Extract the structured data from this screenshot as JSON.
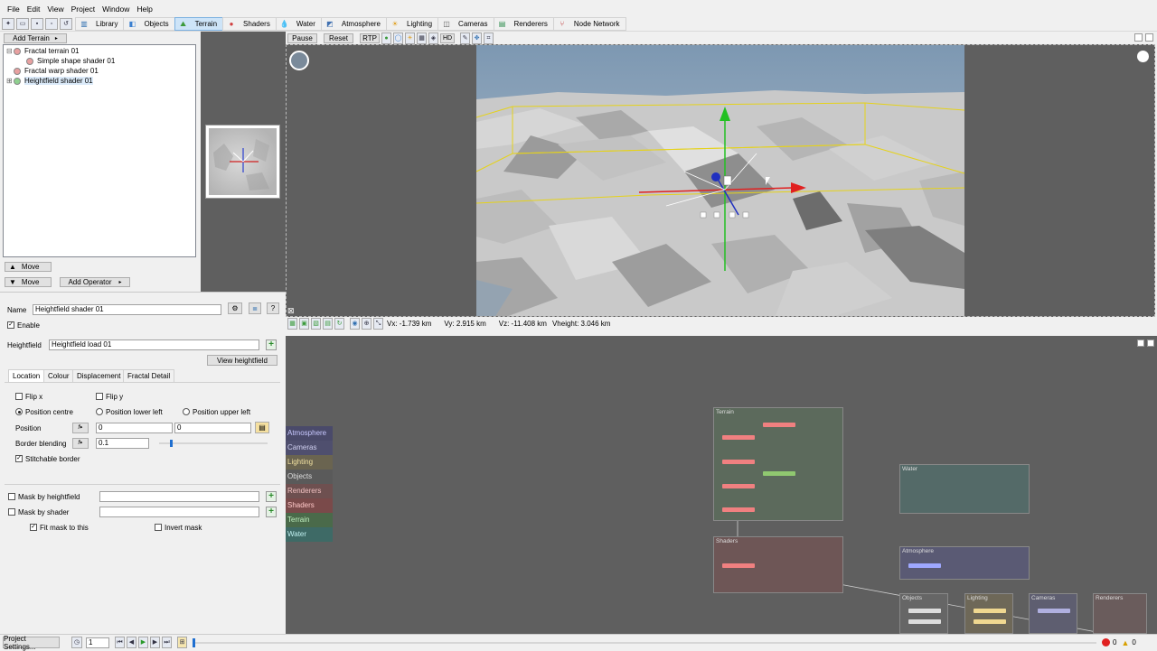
{
  "menu": [
    "File",
    "Edit",
    "View",
    "Project",
    "Window",
    "Help"
  ],
  "toolbar_tabs": [
    {
      "label": "Library",
      "icon": "library-icon"
    },
    {
      "label": "Objects",
      "icon": "objects-icon"
    },
    {
      "label": "Terrain",
      "icon": "terrain-icon"
    },
    {
      "label": "Shaders",
      "icon": "shaders-icon"
    },
    {
      "label": "Water",
      "icon": "water-icon"
    },
    {
      "label": "Atmosphere",
      "icon": "atmosphere-icon"
    },
    {
      "label": "Lighting",
      "icon": "lighting-icon"
    },
    {
      "label": "Cameras",
      "icon": "cameras-icon"
    },
    {
      "label": "Renderers",
      "icon": "renderers-icon"
    },
    {
      "label": "Node Network",
      "icon": "node-network-icon"
    }
  ],
  "active_tab": "Terrain",
  "left": {
    "add_terrain": "Add Terrain",
    "tree": [
      {
        "label": "Fractal terrain 01",
        "dot": "#e8a0a0",
        "level": 0
      },
      {
        "label": "Simple shape shader 01",
        "dot": "#e8a0a0",
        "level": 1
      },
      {
        "label": "Fractal warp shader 01",
        "dot": "#e8a0a0",
        "level": 0
      },
      {
        "label": "Heightfield shader 01",
        "dot": "#8fd08f",
        "level": 0
      }
    ],
    "move_up": "Move",
    "move_down": "Move",
    "add_operator": "Add Operator"
  },
  "props": {
    "name_label": "Name",
    "name_value": "Heightfield shader 01",
    "enable_label": "Enable",
    "heightfield_label": "Heightfield",
    "heightfield_value": "Heightfield load 01",
    "view_heightfield": "View heightfield",
    "tabs": [
      "Location",
      "Colour",
      "Displacement",
      "Fractal Detail"
    ],
    "flip_x": "Flip x",
    "flip_y": "Flip y",
    "pos_centre": "Position centre",
    "pos_lower_left": "Position lower left",
    "pos_upper_left": "Position upper left",
    "position_label": "Position",
    "position_x": "0",
    "position_y": "0",
    "border_blending_label": "Border blending",
    "border_blending_value": "0.1",
    "stitchable_border": "Stitchable border",
    "mask_heightfield": "Mask by heightfield",
    "mask_shader": "Mask by shader",
    "fit_mask": "Fit mask to this",
    "invert_mask": "Invert mask"
  },
  "viewport": {
    "pause": "Pause",
    "reset": "Reset",
    "rtp": "RTP",
    "hd": "HD",
    "vx": "Vx: -1.739 km",
    "vy": "Vy: 2.915 km",
    "vz": "Vz: -11.408 km",
    "vheight": "Vheight: 3.046 km"
  },
  "node_network": {
    "legend": [
      {
        "label": "Atmosphere",
        "color": "#4a4a6a",
        "text": "#c8c8ff"
      },
      {
        "label": "Cameras",
        "color": "#4f4f6e",
        "text": "#d0d0f0"
      },
      {
        "label": "Lighting",
        "color": "#6a6450",
        "text": "#f0e0a0"
      },
      {
        "label": "Objects",
        "color": "#5a5a5a",
        "text": "#dddddd"
      },
      {
        "label": "Renderers",
        "color": "#6e5050",
        "text": "#f0c0c0"
      },
      {
        "label": "Shaders",
        "color": "#7a4a4a",
        "text": "#ffc8c8"
      },
      {
        "label": "Terrain",
        "color": "#4a6a4a",
        "text": "#c0f0c0"
      },
      {
        "label": "Water",
        "color": "#3e6a66",
        "text": "#c0f0f0"
      }
    ],
    "groups": {
      "terrain": "Terrain",
      "shaders": "Shaders",
      "water": "Water",
      "atmosphere": "Atmosphere",
      "objects": "Objects",
      "lighting": "Lighting",
      "cameras": "Cameras",
      "renderers": "Renderers"
    }
  },
  "bottom": {
    "project_settings": "Project Settings...",
    "frame": "1",
    "errors": "0",
    "warnings": "0"
  }
}
